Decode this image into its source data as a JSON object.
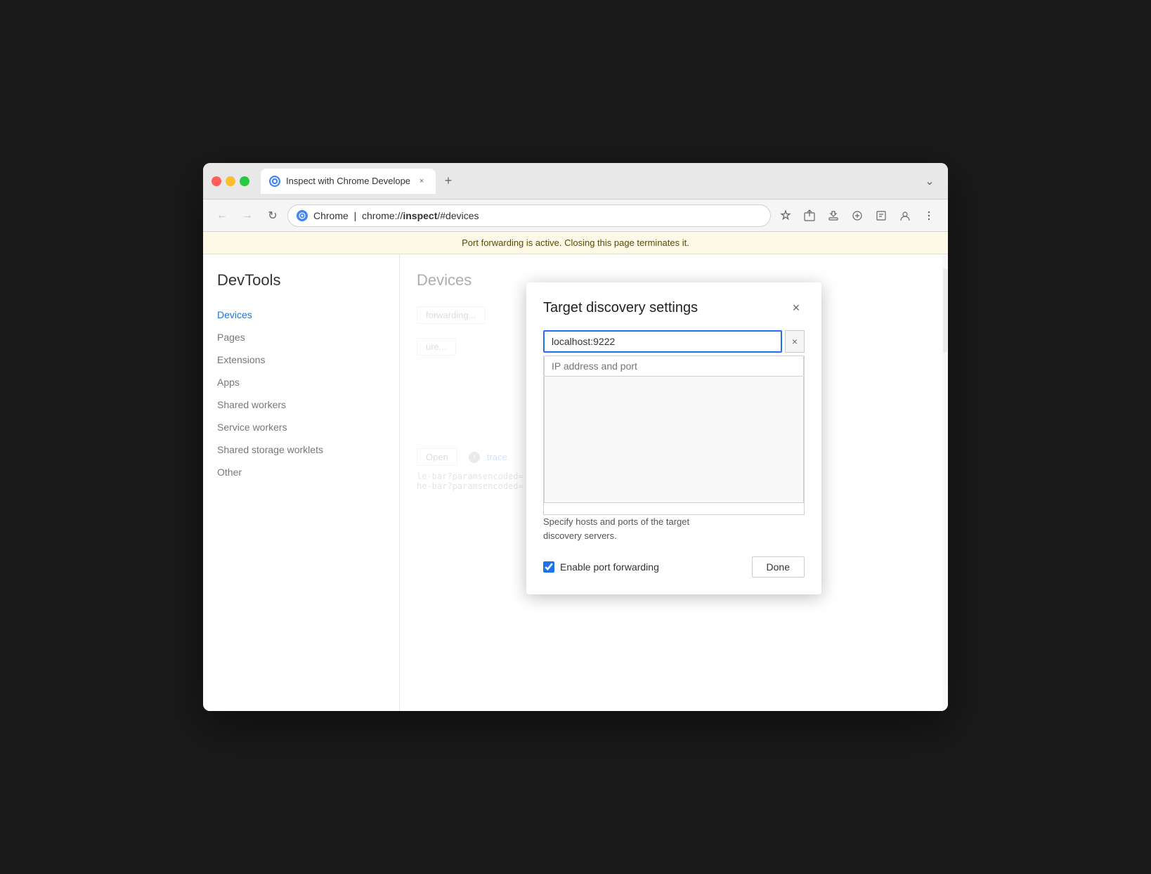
{
  "browser": {
    "tab": {
      "title": "Inspect with Chrome Develope",
      "favicon": "C"
    },
    "address": {
      "prefix": "Chrome  |  chrome://",
      "bold": "inspect",
      "suffix": "/#devices"
    },
    "new_tab_label": "+",
    "overflow_label": "⌄"
  },
  "notification": {
    "text": "Port forwarding is active. Closing this page terminates it."
  },
  "sidebar": {
    "title": "DevTools",
    "items": [
      {
        "label": "Devices",
        "active": true
      },
      {
        "label": "Pages",
        "active": false
      },
      {
        "label": "Extensions",
        "active": false
      },
      {
        "label": "Apps",
        "active": false
      },
      {
        "label": "Shared workers",
        "active": false
      },
      {
        "label": "Service workers",
        "active": false
      },
      {
        "label": "Shared storage worklets",
        "active": false
      },
      {
        "label": "Other",
        "active": false
      }
    ]
  },
  "main": {
    "page_title": "Devices"
  },
  "dialog": {
    "title": "Target discovery settings",
    "close_icon": "×",
    "input_value": "localhost:9222",
    "input_placeholder": "IP address and port",
    "clear_icon": "×",
    "description": "Specify hosts and ports of the target\ndiscovery servers.",
    "checkbox_label": "Enable port forwarding",
    "checkbox_checked": true,
    "done_button": "Done"
  },
  "background": {
    "btn_forwarding": "forwarding...",
    "btn_configure": "ure...",
    "btn_open": "Open",
    "trace_label": "trace",
    "url1": "le-bar?paramsencoded=",
    "url2": "he-bar?paramsencoded="
  }
}
